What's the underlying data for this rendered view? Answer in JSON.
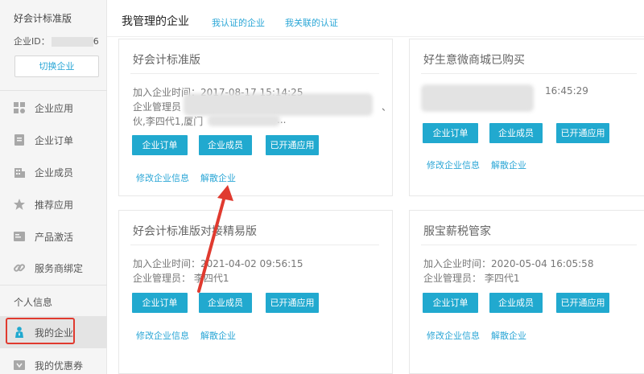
{
  "sidebar": {
    "title": "好会计标准版",
    "id_label": "企业ID：",
    "id_tail": "6",
    "switch_button": "切换企业",
    "items": [
      {
        "label": "企业应用",
        "icon": "grid-icon"
      },
      {
        "label": "企业订单",
        "icon": "document-icon"
      },
      {
        "label": "企业成员",
        "icon": "building-icon"
      },
      {
        "label": "推荐应用",
        "icon": "star-icon"
      },
      {
        "label": "产品激活",
        "icon": "card-icon"
      },
      {
        "label": "服务商绑定",
        "icon": "link-icon"
      }
    ],
    "section_label": "个人信息",
    "personal_items": [
      {
        "label": "我的企业",
        "icon": "person-icon",
        "active": true
      },
      {
        "label": "我的优惠券",
        "icon": "coupon-icon"
      }
    ]
  },
  "header": {
    "main_tab": "我管理的企业",
    "tabs": [
      "我认证的企业",
      "我关联的认证"
    ]
  },
  "cards": [
    {
      "title": "好会计标准版",
      "line1": "加入企业时间：2017-08-17 15:14:25",
      "line2": "企业管理员",
      "line3": "伙,李四代1,厦门",
      "line3_tail": "...",
      "line2_tail": "、",
      "buttons": [
        "企业订单",
        "企业成员",
        "已开通应用"
      ],
      "links": [
        "修改企业信息",
        "解散企业"
      ]
    },
    {
      "title": "好生意微商城已购买",
      "line1_tail": "16:45:29",
      "buttons": [
        "企业订单",
        "企业成员",
        "已开通应用"
      ],
      "links": [
        "修改企业信息",
        "解散企业"
      ]
    },
    {
      "title": "好会计标准版对接精易版",
      "line1": "加入企业时间：2021-04-02 09:56:15",
      "line2": "企业管理员：  李四代1",
      "buttons": [
        "企业订单",
        "企业成员",
        "已开通应用"
      ],
      "links": [
        "修改企业信息",
        "解散企业"
      ]
    },
    {
      "title": "服宝薪税管家",
      "line1": "加入企业时间：2020-05-04 16:05:58",
      "line2": "企业管理员：  李四代1",
      "buttons": [
        "企业订单",
        "企业成员",
        "已开通应用"
      ],
      "links": [
        "修改企业信息",
        "解散企业"
      ]
    }
  ],
  "colors": {
    "accent": "#21a9cf",
    "link": "#2aa6d6",
    "annotation_red": "#e03a2f"
  }
}
